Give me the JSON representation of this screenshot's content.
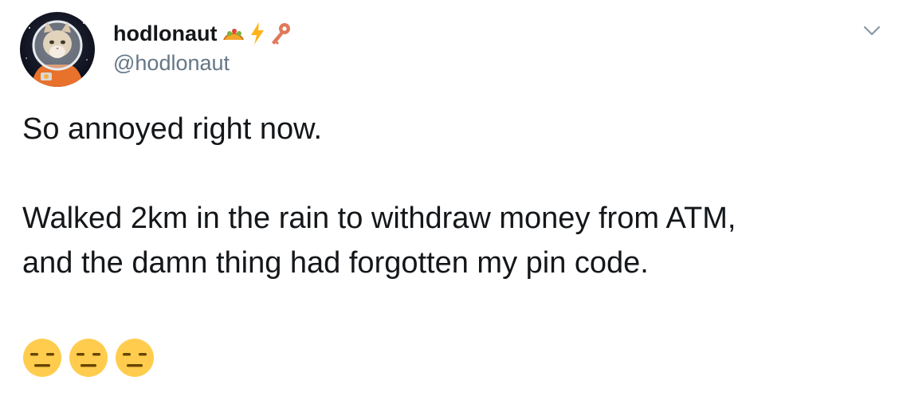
{
  "tweet": {
    "display_name": "hodlonaut",
    "handle": "@hodlonaut",
    "name_emojis": [
      "taco-emoji",
      "lightning-emoji",
      "key-emoji"
    ],
    "text_lines": [
      "So annoyed right now.",
      "",
      "Walked 2km in the rain to withdraw money from ATM,",
      "and the damn thing had forgotten my pin code."
    ],
    "trailing_emojis": [
      "expressionless-face-emoji",
      "expressionless-face-emoji",
      "expressionless-face-emoji"
    ],
    "menu_icon": "chevron-down-icon",
    "avatar_icon": "cat-astronaut-avatar"
  },
  "colors": {
    "text": "#14171a",
    "secondary_text": "#657786",
    "caret": "#8899a6",
    "emoji_face": "#FFCC4D",
    "background": "#ffffff"
  }
}
